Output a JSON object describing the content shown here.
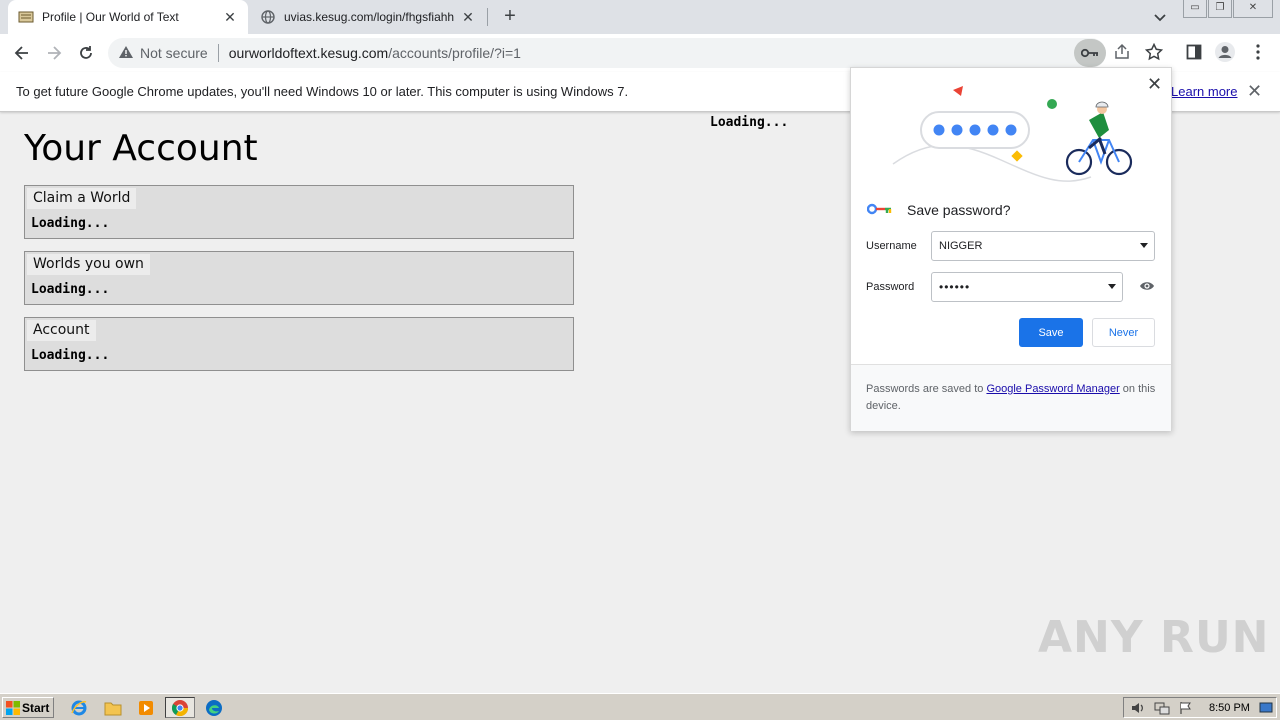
{
  "browser": {
    "tabs": [
      {
        "title": "Profile | Our World of Text",
        "active": true
      },
      {
        "title": "uvias.kesug.com/login/fhgsfiahhhhh",
        "active": false
      }
    ],
    "omnibox": {
      "security": "Not secure",
      "host": "ourworldoftext.kesug.com",
      "path": "/accounts/profile/?i=1"
    },
    "infobar": {
      "message": "To get future Google Chrome updates, you'll need Windows 10 or later. This computer is using Windows 7.",
      "link": "Learn more"
    }
  },
  "page": {
    "title": "Your Account",
    "loading_top": "Loading...",
    "panels": [
      {
        "title": "Claim a World",
        "status": "Loading..."
      },
      {
        "title": "Worlds you own",
        "status": "Loading..."
      },
      {
        "title": "Account",
        "status": "Loading..."
      }
    ]
  },
  "password_bubble": {
    "title": "Save password?",
    "username_label": "Username",
    "username_value": "NIGGER",
    "password_label": "Password",
    "password_value": "••••••",
    "save_label": "Save",
    "never_label": "Never",
    "footer_prefix": "Passwords are saved to ",
    "footer_link": "Google Password Manager",
    "footer_suffix": " on this device."
  },
  "watermark": "ANY RUN",
  "taskbar": {
    "start_label": "Start",
    "clock": "8:50 PM"
  },
  "colors": {
    "accent": "#1a73e8",
    "tabstrip": "#dee1e6",
    "page_bg": "#efefef"
  }
}
